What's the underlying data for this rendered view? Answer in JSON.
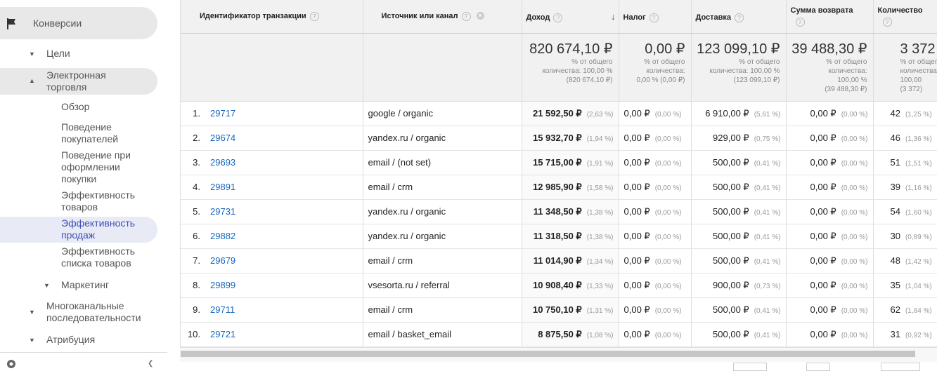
{
  "sidebar": {
    "conversions": "Конверсии",
    "goals": "Цели",
    "ecommerce": "Электронная торговля",
    "items": [
      "Обзор",
      "Поведение покупателей",
      "Поведение при оформлении покупки",
      "Эффективность товаров",
      "Эффективность продаж",
      "Эффективность списка товаров"
    ],
    "marketing": "Маркетинг",
    "multichannel": "Многоканальные последовательности",
    "attribution": "Атрибуция"
  },
  "table": {
    "headers": {
      "transaction_id": "Идентификатор транзакции",
      "source": "Источник или канал",
      "revenue": "Доход",
      "tax": "Налог",
      "shipping": "Доставка",
      "refund": "Сумма возврата",
      "quantity": "Количество"
    },
    "totals": {
      "revenue": {
        "value": "820 674,10 ₽",
        "line1": "% от общего",
        "line2": "количества: 100,00 %",
        "line3": "(820 674,10 ₽)"
      },
      "tax": {
        "value": "0,00 ₽",
        "line1": "% от общего",
        "line2": "количества:",
        "line3": "0,00 % (0,00 ₽)"
      },
      "shipping": {
        "value": "123 099,10 ₽",
        "line1": "% от общего",
        "line2": "количества: 100,00 %",
        "line3": "(123 099,10 ₽)"
      },
      "refund": {
        "value": "39 488,30 ₽",
        "line1": "% от общего",
        "line2": "количества:",
        "line3": "100,00 %",
        "line4": "(39 488,30 ₽)"
      },
      "quantity": {
        "value": "3 372",
        "line1": "% от общего",
        "line2": "количества:",
        "line3": "100,00",
        "line4": "(3 372)"
      }
    },
    "rows": [
      {
        "n": "1.",
        "id": "29717",
        "src": "google / organic",
        "rev": "21 592,50 ₽",
        "rev_p": "(2,63 %)",
        "tax": "0,00 ₽",
        "tax_p": "(0,00 %)",
        "ship": "6 910,00 ₽",
        "ship_p": "(5,61 %)",
        "ref": "0,00 ₽",
        "ref_p": "(0,00 %)",
        "qty": "42",
        "qty_p": "(1,25 %)"
      },
      {
        "n": "2.",
        "id": "29674",
        "src": "yandex.ru / organic",
        "rev": "15 932,70 ₽",
        "rev_p": "(1,94 %)",
        "tax": "0,00 ₽",
        "tax_p": "(0,00 %)",
        "ship": "929,00 ₽",
        "ship_p": "(0,75 %)",
        "ref": "0,00 ₽",
        "ref_p": "(0,00 %)",
        "qty": "46",
        "qty_p": "(1,36 %)"
      },
      {
        "n": "3.",
        "id": "29693",
        "src": "email / (not set)",
        "rev": "15 715,00 ₽",
        "rev_p": "(1,91 %)",
        "tax": "0,00 ₽",
        "tax_p": "(0,00 %)",
        "ship": "500,00 ₽",
        "ship_p": "(0,41 %)",
        "ref": "0,00 ₽",
        "ref_p": "(0,00 %)",
        "qty": "51",
        "qty_p": "(1,51 %)"
      },
      {
        "n": "4.",
        "id": "29891",
        "src": "email / crm",
        "rev": "12 985,90 ₽",
        "rev_p": "(1,58 %)",
        "tax": "0,00 ₽",
        "tax_p": "(0,00 %)",
        "ship": "500,00 ₽",
        "ship_p": "(0,41 %)",
        "ref": "0,00 ₽",
        "ref_p": "(0,00 %)",
        "qty": "39",
        "qty_p": "(1,16 %)"
      },
      {
        "n": "5.",
        "id": "29731",
        "src": "yandex.ru / organic",
        "rev": "11 348,50 ₽",
        "rev_p": "(1,38 %)",
        "tax": "0,00 ₽",
        "tax_p": "(0,00 %)",
        "ship": "500,00 ₽",
        "ship_p": "(0,41 %)",
        "ref": "0,00 ₽",
        "ref_p": "(0,00 %)",
        "qty": "54",
        "qty_p": "(1,60 %)"
      },
      {
        "n": "6.",
        "id": "29882",
        "src": "yandex.ru / organic",
        "rev": "11 318,50 ₽",
        "rev_p": "(1,38 %)",
        "tax": "0,00 ₽",
        "tax_p": "(0,00 %)",
        "ship": "500,00 ₽",
        "ship_p": "(0,41 %)",
        "ref": "0,00 ₽",
        "ref_p": "(0,00 %)",
        "qty": "30",
        "qty_p": "(0,89 %)"
      },
      {
        "n": "7.",
        "id": "29679",
        "src": "email / crm",
        "rev": "11 014,90 ₽",
        "rev_p": "(1,34 %)",
        "tax": "0,00 ₽",
        "tax_p": "(0,00 %)",
        "ship": "500,00 ₽",
        "ship_p": "(0,41 %)",
        "ref": "0,00 ₽",
        "ref_p": "(0,00 %)",
        "qty": "48",
        "qty_p": "(1,42 %)"
      },
      {
        "n": "8.",
        "id": "29899",
        "src": "vsesorta.ru / referral",
        "rev": "10 908,40 ₽",
        "rev_p": "(1,33 %)",
        "tax": "0,00 ₽",
        "tax_p": "(0,00 %)",
        "ship": "900,00 ₽",
        "ship_p": "(0,73 %)",
        "ref": "0,00 ₽",
        "ref_p": "(0,00 %)",
        "qty": "35",
        "qty_p": "(1,04 %)"
      },
      {
        "n": "9.",
        "id": "29711",
        "src": "email / crm",
        "rev": "10 750,10 ₽",
        "rev_p": "(1,31 %)",
        "tax": "0,00 ₽",
        "tax_p": "(0,00 %)",
        "ship": "500,00 ₽",
        "ship_p": "(0,41 %)",
        "ref": "0,00 ₽",
        "ref_p": "(0,00 %)",
        "qty": "62",
        "qty_p": "(1,84 %)"
      },
      {
        "n": "10.",
        "id": "29721",
        "src": "email / basket_email",
        "rev": "8 875,50 ₽",
        "rev_p": "(1,08 %)",
        "tax": "0,00 ₽",
        "tax_p": "(0,00 %)",
        "ship": "500,00 ₽",
        "ship_p": "(0,41 %)",
        "ref": "0,00 ₽",
        "ref_p": "(0,00 %)",
        "qty": "31",
        "qty_p": "(0,92 %)"
      }
    ]
  }
}
